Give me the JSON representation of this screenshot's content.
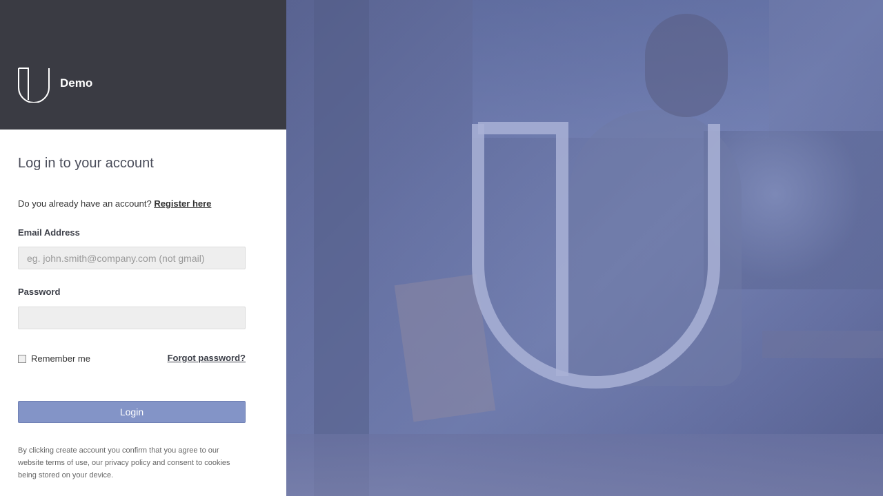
{
  "brand": {
    "name": "Demo",
    "logo_icon": "u-logo-icon"
  },
  "login": {
    "title": "Log in to your account",
    "register_prompt": "Do you already have an account?",
    "register_link": "Register here",
    "email_label": "Email Address",
    "email_placeholder": "eg. john.smith@company.com (not gmail)",
    "email_value": "",
    "password_label": "Password",
    "password_value": "",
    "remember_label": "Remember me",
    "remember_checked": false,
    "forgot_link": "Forgot password?",
    "submit_label": "Login",
    "legal_text": "By clicking create account you confirm that you agree to our website terms of use, our privacy policy and consent to cookies being stored on your device."
  },
  "hero": {
    "overlay_color": "#6b77a8",
    "logo_icon": "u-logo-icon"
  },
  "colors": {
    "brand_bar": "#3a3b43",
    "button": "#8394c7",
    "overlay": "#6b77a8"
  }
}
